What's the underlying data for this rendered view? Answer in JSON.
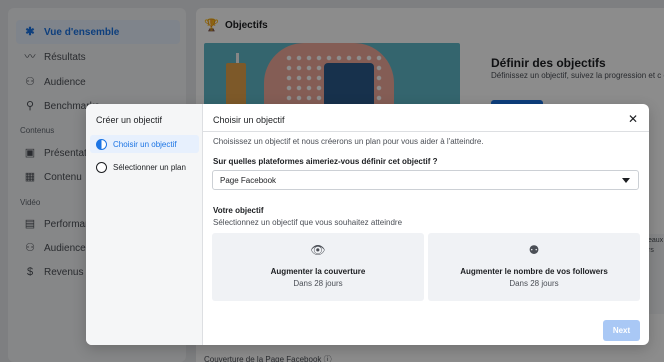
{
  "sidebar": {
    "items": [
      {
        "label": "Vue d'ensemble",
        "icon": "overview-icon",
        "glyph": "✱",
        "active": true
      },
      {
        "label": "Résultats",
        "icon": "results-icon",
        "glyph": "〰"
      },
      {
        "label": "Audience",
        "icon": "audience-icon",
        "glyph": "⚇"
      },
      {
        "label": "Benchmarks",
        "icon": "benchmark-icon",
        "glyph": "⚲"
      }
    ],
    "section_content": "Contenus",
    "content_items": [
      {
        "label": "Présentation",
        "icon": "presentation-icon",
        "glyph": "▣"
      },
      {
        "label": "Contenu",
        "icon": "content-icon",
        "glyph": "▦"
      }
    ],
    "section_video": "Vidéo",
    "video_items": [
      {
        "label": "Performances",
        "icon": "performance-icon",
        "glyph": "▤"
      },
      {
        "label": "Audience",
        "icon": "video-audience-icon",
        "glyph": "⚇"
      },
      {
        "label": "Revenus",
        "icon": "revenue-icon",
        "glyph": "$"
      }
    ]
  },
  "main": {
    "section_title": "Objectifs",
    "card_title": "Définir des objectifs",
    "card_desc": "Définissez un objectif, suivez la progression et c des conseils utiles pour votre réussite professi",
    "footer_text": "Couverture de la Page Facebook ⓘ",
    "right_text": "eaux rs"
  },
  "modal": {
    "left_title": "Créer un objectif",
    "steps": [
      {
        "label": "Choisir un objectif",
        "active": true
      },
      {
        "label": "Sélectionner un plan",
        "active": false
      }
    ],
    "title": "Choisir un objectif",
    "close_glyph": "✕",
    "intro": "Choisissez un objectif et nous créerons un plan pour vous aider à l'atteindre.",
    "platform_question": "Sur quelles plateformes aimeriez-vous définir cet objectif ?",
    "platform_value": "Page Facebook",
    "goal_title": "Votre objectif",
    "goal_subtitle": "Sélectionnez un objectif que vous souhaitez atteindre",
    "options": [
      {
        "label": "Augmenter la couverture",
        "sub": "Dans 28 jours",
        "icon": "eye-icon",
        "glyph": "👁"
      },
      {
        "label": "Augmenter le nombre de vos followers",
        "sub": "Dans 28 jours",
        "icon": "followers-icon",
        "glyph": "⚉"
      }
    ],
    "next_label": "Next"
  },
  "colors": {
    "accent": "#1b74e4",
    "next_disabled": "#a9c8f5"
  }
}
